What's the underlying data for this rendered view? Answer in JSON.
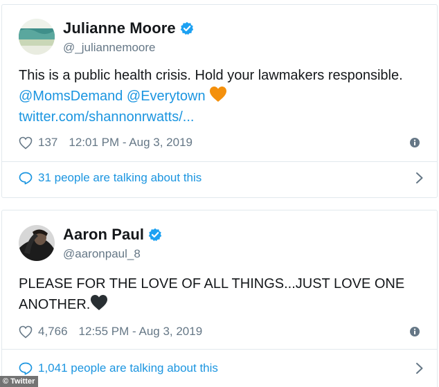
{
  "tweets": [
    {
      "display_name": "Julianne Moore",
      "handle": "@_juliannemoore",
      "text_1": "This is a public health crisis.  Hold your lawmakers responsible.  ",
      "mention_1": "@MomsDemand",
      "mention_2": "@Everytown",
      "link": "twitter.com/shannonrwatts/...",
      "emoji": "orange-heart",
      "likes": "137",
      "timestamp": "12:01 PM - Aug 3, 2019",
      "talking": "31 people are talking about this"
    },
    {
      "display_name": "Aaron Paul",
      "handle": "@aaronpaul_8",
      "text_1": "PLEASE FOR THE LOVE OF ALL THINGS...JUST LOVE ONE ANOTHER.",
      "emoji": "black-heart",
      "likes": "4,766",
      "timestamp": "12:55 PM - Aug 3, 2019",
      "talking": "1,041 people are talking about this"
    }
  ],
  "credit": {
    "symbol": "©",
    "label": "Twitter"
  },
  "colors": {
    "link": "#1b95e0",
    "muted": "#657786",
    "verified": "#1da1f2",
    "border": "#e1e8ed",
    "orange_heart": "#f4900c",
    "black_heart": "#292f33"
  },
  "icons": [
    "verified-badge-icon",
    "heart-icon",
    "info-icon",
    "speech-bubble-icon",
    "chevron-right-icon"
  ]
}
